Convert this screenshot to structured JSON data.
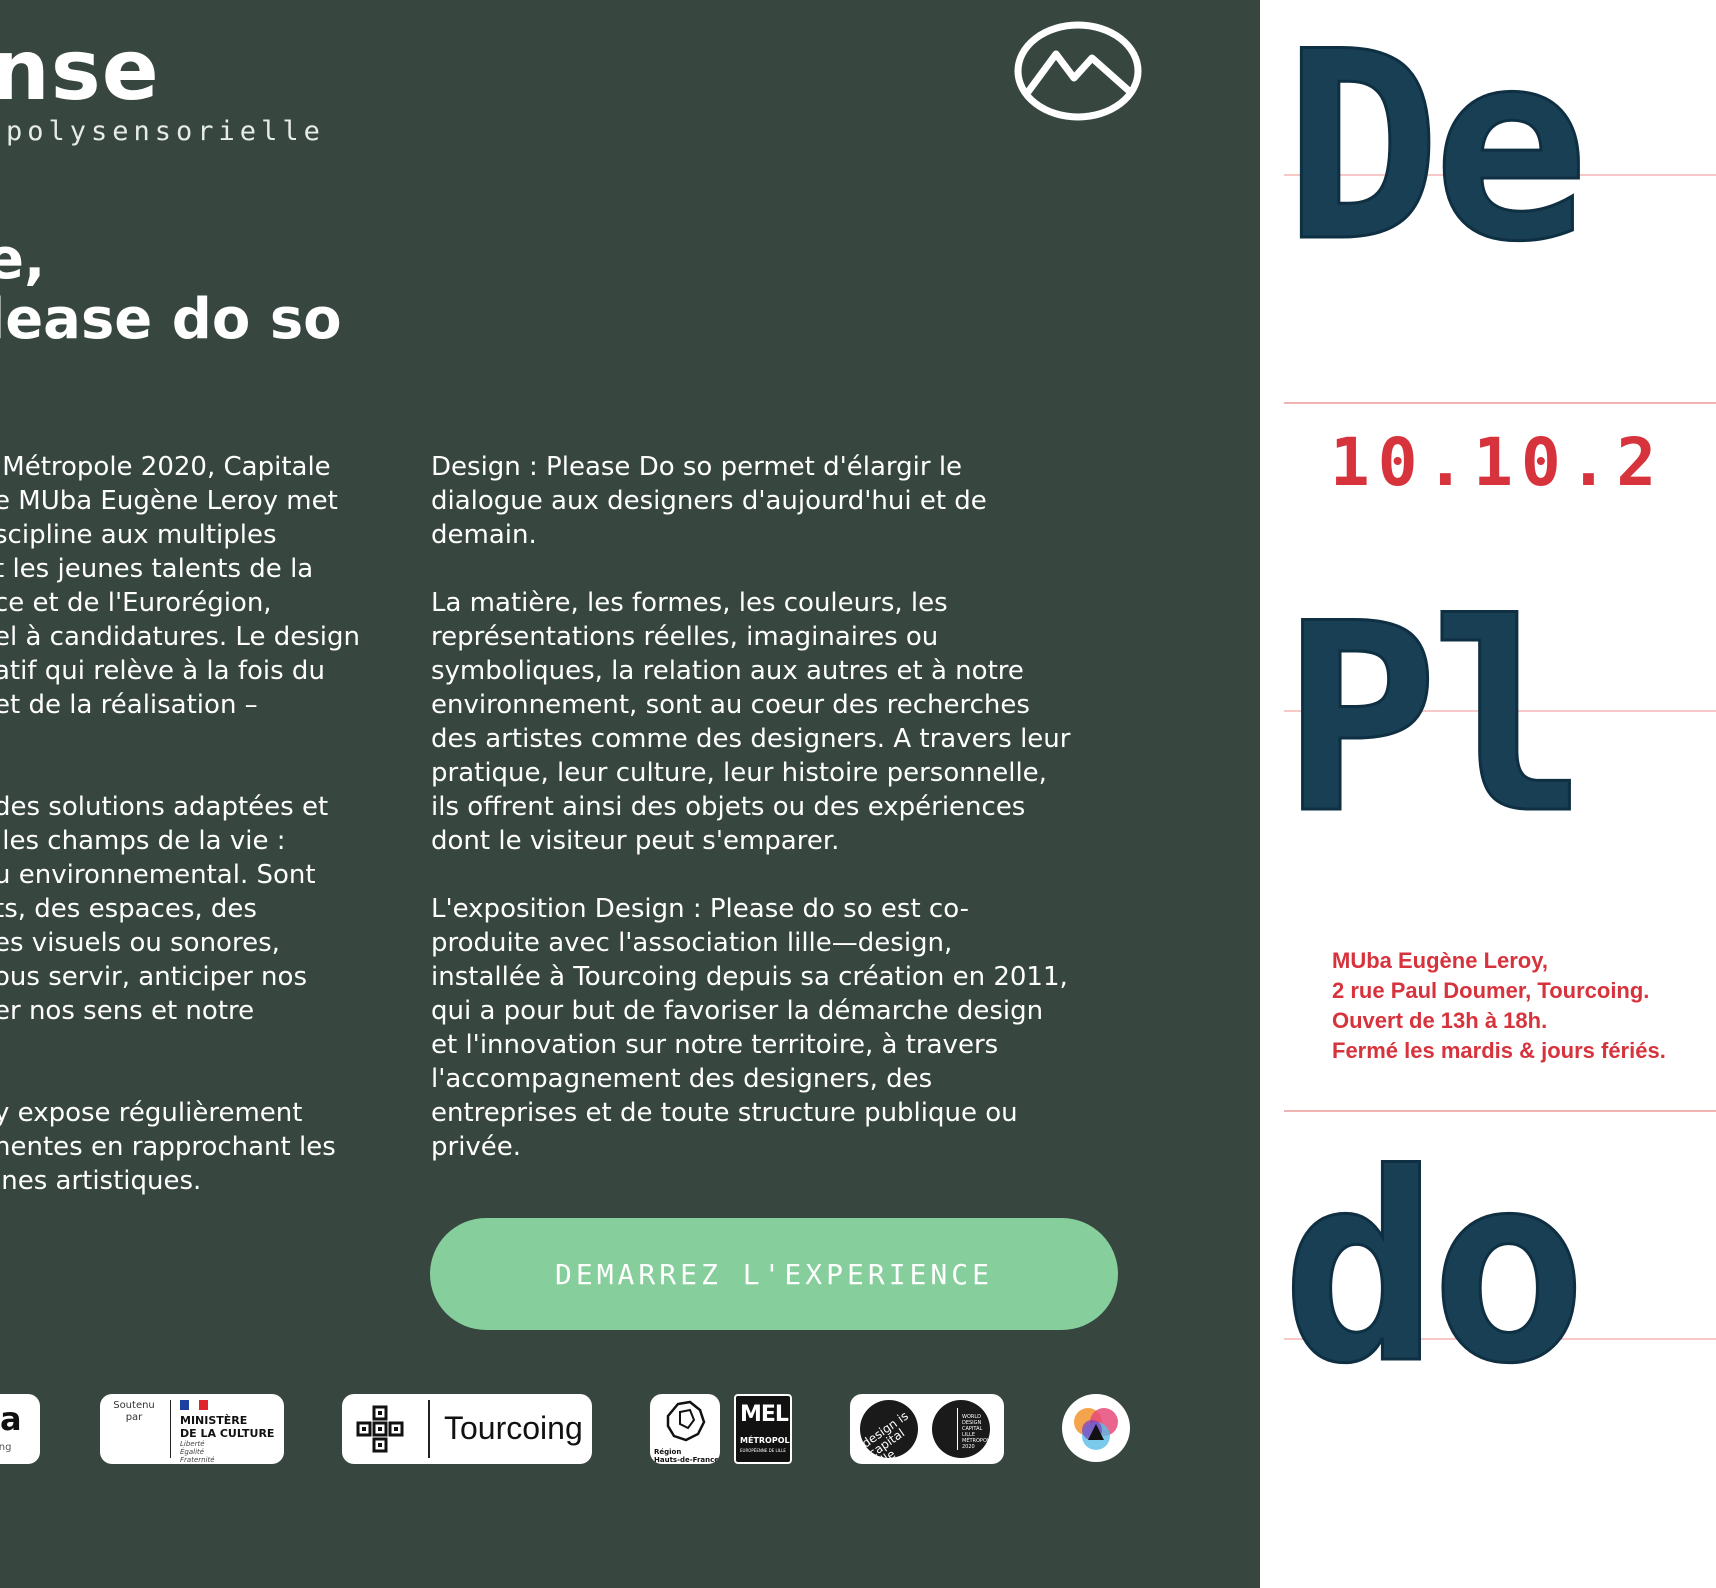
{
  "brand": {
    "title": "nse",
    "subtitle": "polysensorielle"
  },
  "icons": {
    "logo": "mountain-circle-icon",
    "ministry_flag": "french-flag-icon",
    "tourcoing": "tourcoing-cross-icon",
    "region": "region-map-icon"
  },
  "headline": {
    "line1": "e,",
    "line2": "lease do so"
  },
  "intro_left": [
    " Métropole 2020, Capitale",
    "e MUba Eugène Leroy met",
    "scipline aux multiples",
    "t les jeunes talents de la",
    "ce et de l'Eurorégion,",
    "el à candidatures. Le design",
    "atif qui relève à la fois du",
    "et de la réalisation –",
    "",
    "",
    "des solutions adaptées et",
    " les champs de la vie :",
    "u environnemental. Sont",
    "ts, des espaces, des",
    "es visuels ou sonores,",
    "ous servir, anticiper nos",
    "er nos sens et notre",
    "",
    "",
    "y expose régulièrement",
    "nentes en rapprochant les",
    "ines artistiques."
  ],
  "intro_right": [
    "Design : Please Do so permet d'élargir le",
    "dialogue aux designers d'aujourd'hui et de",
    "demain.",
    "",
    "La matière, les formes, les couleurs, les",
    "représentations réelles, imaginaires ou",
    "symboliques, la relation aux autres et à notre",
    "environnement, sont au coeur des recherches",
    "des artistes comme des designers. A travers leur",
    "pratique, leur culture, leur histoire personnelle,",
    "ils offrent ainsi des objets ou des expériences",
    "dont le visiteur peut s'emparer.",
    "",
    "L'exposition Design : Please do so est co-",
    "produite avec l'association lille—design,",
    "installée à Tourcoing depuis sa création en 2011,",
    "qui a pour but de favoriser la démarche design",
    "et l'innovation sur notre territoire, à travers",
    "l'accompagnement des designers, des",
    "entreprises et de toute structure publique ou",
    "privée."
  ],
  "cta": {
    "label": "DEMARREZ L'EXPERIENCE"
  },
  "partners": {
    "muba": {
      "big": "a",
      "small": "ing"
    },
    "culture": {
      "soutenu": "Soutenu par",
      "line1": "MINISTÈRE",
      "line2": "DE LA CULTURE",
      "motto1": "Liberté",
      "motto2": "Égalité",
      "motto3": "Fraternité"
    },
    "tourcoing": {
      "label": "Tourcoing"
    },
    "region": {
      "line1": "Région",
      "line2": "Hauts-de-France"
    },
    "mel": {
      "big": "MEL",
      "small": "MÉTROPOLE",
      "tiny": "EUROPÉENNE DE LILLE"
    },
    "wdc": {
      "circle1": "design is capital lille métropole",
      "circle2": "WORLD DESIGN CAPITAL LILLE MÉTROPOLE 2020"
    }
  },
  "poster": {
    "word1": "De",
    "date": "10.10.2",
    "word2": "Pl",
    "address": [
      "MUba Eugène Leroy,",
      "2 rue Paul Doumer, Tourcoing.",
      "Ouvert de 13h à 18h.",
      "Fermé les mardis & jours fériés."
    ],
    "word3": "do"
  },
  "colors": {
    "panel": "#374740",
    "cta": "#86ce9b",
    "poster_red": "#d7333d",
    "poster_blue": "#183f54",
    "guide_line": "#f6c8c8"
  }
}
